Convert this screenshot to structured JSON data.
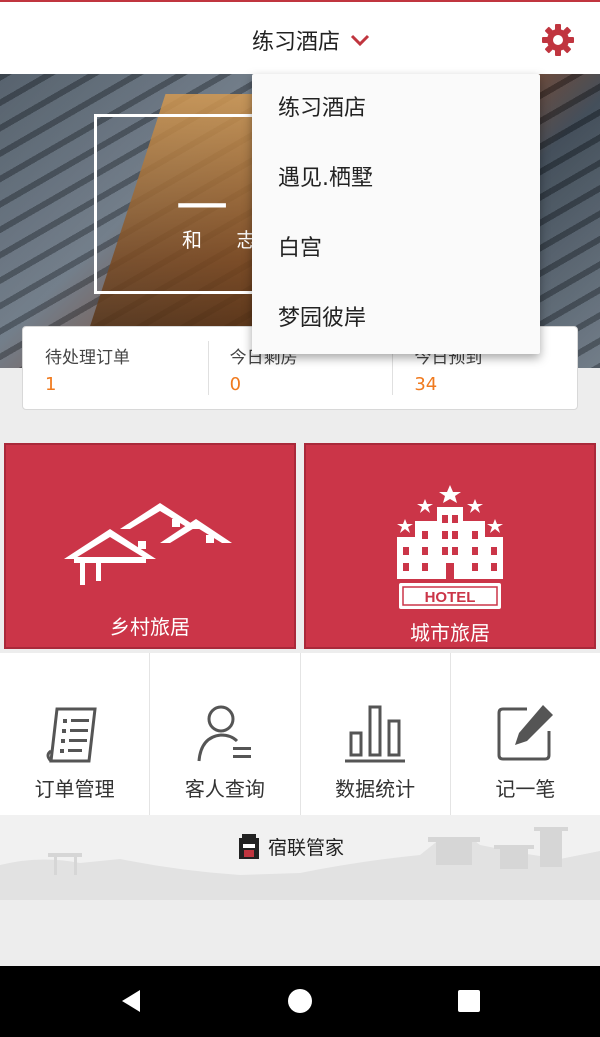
{
  "header": {
    "hotel_name": "练习酒店"
  },
  "banner": {
    "big_char": "一",
    "small_chars": "和 志"
  },
  "stats": [
    {
      "label": "待处理订单",
      "value": "1"
    },
    {
      "label": "今日剩房",
      "value": "0"
    },
    {
      "label": "今日预到",
      "value": "34"
    }
  ],
  "tiles": {
    "rural": "乡村旅居",
    "city": "城市旅居",
    "hotel_sign": "HOTEL"
  },
  "features": [
    {
      "label": "订单管理",
      "icon": "order-document-icon"
    },
    {
      "label": "客人查询",
      "icon": "guest-search-icon"
    },
    {
      "label": "数据统计",
      "icon": "bar-chart-icon"
    },
    {
      "label": "记一笔",
      "icon": "note-edit-icon"
    }
  ],
  "footer": {
    "brand": "宿联管家"
  },
  "dropdown": {
    "items": [
      "练习酒店",
      "遇见.栖墅",
      "白宫",
      "梦园彼岸"
    ]
  },
  "colors": {
    "accent": "#cb3548",
    "number": "#f07a1e"
  }
}
